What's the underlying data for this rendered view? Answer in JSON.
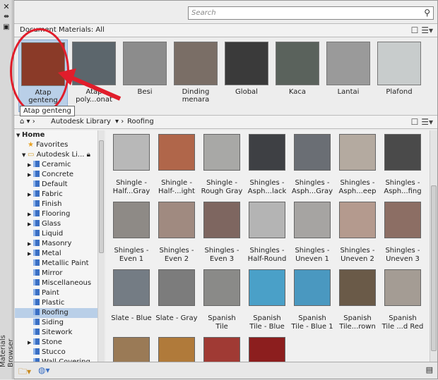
{
  "window": {
    "vertical_title": "Materials Browser"
  },
  "search": {
    "placeholder": "Search"
  },
  "document_bar": {
    "label": "Document Materials: All"
  },
  "document_materials": [
    {
      "label": "Atap genteng",
      "line1": "Atap",
      "line2": "genteng",
      "color": "#8a3a28",
      "selected": true
    },
    {
      "label": "Atap polycarbonat",
      "line1": "Atap",
      "line2": "poly...onat",
      "color": "#5c666c"
    },
    {
      "label": "Besi",
      "line1": "Besi",
      "line2": "",
      "color": "#8c8c8c"
    },
    {
      "label": "Dinding menara",
      "line1": "Dinding",
      "line2": "menara",
      "color": "#7a6e66"
    },
    {
      "label": "Global",
      "line1": "Global",
      "line2": "",
      "color": "#3a3a3a"
    },
    {
      "label": "Kaca",
      "line1": "Kaca",
      "line2": "",
      "color": "#5a625c"
    },
    {
      "label": "Lantai",
      "line1": "Lantai",
      "line2": "",
      "color": "#9a9a9a"
    },
    {
      "label": "Plafond",
      "line1": "Plafond",
      "line2": "",
      "color": "#c8cccc"
    }
  ],
  "tooltip": "Atap genteng",
  "library_bar": {
    "library": "Autodesk Library",
    "category": "Roofing"
  },
  "tree": [
    {
      "label": "Home",
      "level": 0,
      "twisty": "▼",
      "bold": true
    },
    {
      "label": "Favorites",
      "level": 1,
      "icon": "star"
    },
    {
      "label": "Autodesk Li...",
      "level": 1,
      "twisty": "▼",
      "icon": "folder",
      "locked": true
    },
    {
      "label": "Ceramic",
      "level": 2,
      "twisty": "▶"
    },
    {
      "label": "Concrete",
      "level": 2,
      "twisty": "▶"
    },
    {
      "label": "Default",
      "level": 2
    },
    {
      "label": "Fabric",
      "level": 2,
      "twisty": "▶"
    },
    {
      "label": "Finish",
      "level": 2
    },
    {
      "label": "Flooring",
      "level": 2,
      "twisty": "▶"
    },
    {
      "label": "Glass",
      "level": 2,
      "twisty": "▶"
    },
    {
      "label": "Liquid",
      "level": 2
    },
    {
      "label": "Masonry",
      "level": 2,
      "twisty": "▶"
    },
    {
      "label": "Metal",
      "level": 2,
      "twisty": "▶"
    },
    {
      "label": "Metallic Paint",
      "level": 2
    },
    {
      "label": "Mirror",
      "level": 2
    },
    {
      "label": "Miscellaneous",
      "level": 2
    },
    {
      "label": "Paint",
      "level": 2
    },
    {
      "label": "Plastic",
      "level": 2
    },
    {
      "label": "Roofing",
      "level": 2,
      "selected": true
    },
    {
      "label": "Siding",
      "level": 2
    },
    {
      "label": "Sitework",
      "level": 2
    },
    {
      "label": "Stone",
      "level": 2,
      "twisty": "▶"
    },
    {
      "label": "Stucco",
      "level": 2
    },
    {
      "label": "Wall Covering",
      "level": 2
    }
  ],
  "library_materials": [
    {
      "line1": "Shingle -",
      "line2": "Half...Gray",
      "color": "#b8b8b8"
    },
    {
      "line1": "Shingle -",
      "line2": "Half-...ight",
      "color": "#b0664a"
    },
    {
      "line1": "Shingle -",
      "line2": "Rough Gray",
      "color": "#a8a8a6"
    },
    {
      "line1": "Shingles -",
      "line2": "Asph...lack",
      "color": "#3e4044"
    },
    {
      "line1": "Shingles -",
      "line2": "Asph...Gray",
      "color": "#6a6e74"
    },
    {
      "line1": "Shingles -",
      "line2": "Asph...eep",
      "color": "#b4aaa0"
    },
    {
      "line1": "Shingles -",
      "line2": "Asph...fing",
      "color": "#4a4a4a"
    },
    {
      "line1": "Shingles -",
      "line2": "Even 1",
      "color": "#8e8a86"
    },
    {
      "line1": "Shingles -",
      "line2": "Even 2",
      "color": "#a08a80"
    },
    {
      "line1": "Shingles -",
      "line2": "Even 3",
      "color": "#7e6660"
    },
    {
      "line1": "Shingles -",
      "line2": "Half-Round",
      "color": "#b4b4b4"
    },
    {
      "line1": "Shingles -",
      "line2": "Uneven 1",
      "color": "#a6a4a2"
    },
    {
      "line1": "Shingles -",
      "line2": "Uneven 2",
      "color": "#b49a8e"
    },
    {
      "line1": "Shingles -",
      "line2": "Uneven 3",
      "color": "#8c6e64"
    },
    {
      "line1": "Slate - Blue",
      "line2": "",
      "color": "#747c84"
    },
    {
      "line1": "Slate - Gray",
      "line2": "",
      "color": "#7c7c7c"
    },
    {
      "line1": "Spanish",
      "line2": "Tile",
      "color": "#8a8a88"
    },
    {
      "line1": "Spanish",
      "line2": "Tile - Blue",
      "color": "#4aa0c8"
    },
    {
      "line1": "Spanish",
      "line2": "Tile - Blue 1",
      "color": "#4a98c0"
    },
    {
      "line1": "Spanish",
      "line2": "Tile...rown",
      "color": "#6a5a48"
    },
    {
      "line1": "Spanish",
      "line2": "Tile ...d Red",
      "color": "#a49c94"
    },
    {
      "line1": "",
      "line2": "",
      "color": "#9a7a56"
    },
    {
      "line1": "",
      "line2": "",
      "color": "#b07a3a"
    },
    {
      "line1": "",
      "line2": "",
      "color": "#a03a34"
    },
    {
      "line1": "",
      "line2": "",
      "color": "#8c1e1e"
    }
  ],
  "accent": {
    "annotation": "#e11d2b",
    "selection": "#b9cfe8"
  }
}
